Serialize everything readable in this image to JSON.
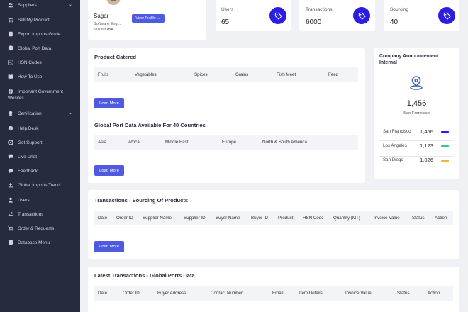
{
  "sidebar": {
    "items": [
      {
        "label": "Suppliers",
        "icon": "people-icon",
        "chevron": "⌄"
      },
      {
        "label": "Sell My Product",
        "icon": "cart-icon"
      },
      {
        "label": "Export Imports Guide",
        "icon": "book-icon"
      },
      {
        "label": "Global Port Data",
        "icon": "database-icon"
      },
      {
        "label": "HSN Codes",
        "icon": "code-icon"
      },
      {
        "label": "How To Use",
        "icon": "book-open-icon"
      },
      {
        "label": "Important Government Wesites",
        "icon": "globe-icon"
      },
      {
        "label": "Certification",
        "icon": "certificate-icon",
        "chevron": "⌄"
      },
      {
        "label": "Help Desk",
        "icon": "help-icon"
      },
      {
        "label": "Get Support",
        "icon": "support-icon"
      },
      {
        "label": "Live Chat",
        "icon": "chat-icon"
      },
      {
        "label": "Feedback",
        "icon": "feedback-icon"
      },
      {
        "label": "Global Imports Trend",
        "icon": "upload-icon"
      },
      {
        "label": "Users",
        "icon": "user-icon"
      },
      {
        "label": "Transactions",
        "icon": "transfer-icon"
      },
      {
        "label": "Order & Requests",
        "icon": "cart-icon"
      },
      {
        "label": "Database Menu",
        "icon": "database-icon"
      }
    ]
  },
  "profile": {
    "name": "Sagar",
    "role": "Software Eng...",
    "org": "Sukkur IBA",
    "button": "View Profile →"
  },
  "stats": [
    {
      "label": "Users",
      "value": "65"
    },
    {
      "label": "Transactions",
      "value": "6000"
    },
    {
      "label": "Sourcing",
      "value": "40"
    }
  ],
  "product_catered": {
    "title": "Product Catered",
    "columns": [
      "Fruits",
      "Vegetables",
      "Spices",
      "Grains",
      "Fish Meet",
      "Feed"
    ],
    "button": "Load More"
  },
  "port_data": {
    "title": "Global Port Data Available For 40 Countries",
    "columns": [
      "Asia",
      "Africa",
      "Middle East",
      "Europe",
      "North & South America"
    ],
    "button": "Load More"
  },
  "announcement": {
    "title_line1": "Company Announcement",
    "title_line2": "Internal",
    "big_value": "1,456",
    "big_city": "San Francisco",
    "rows": [
      {
        "city": "San Francisco",
        "value": "1,456",
        "color": "#2a1fe0"
      },
      {
        "city": "Los Angeles",
        "value": "1,123",
        "color": "#35c790"
      },
      {
        "city": "San Diego",
        "value": "1,026",
        "color": "#f0b43a"
      }
    ]
  },
  "transactions": {
    "title": "Transactions - Sourcing Of Products",
    "columns": [
      "Date",
      "Order ID",
      "Supplier Name",
      "Supplier ID",
      "Buyer Name",
      "Buyer ID",
      "Product",
      "HSN Code",
      "Quantity (MT)",
      "Invoice Value",
      "Status",
      "Action"
    ],
    "button": "Load More"
  },
  "latest": {
    "title": "Latest Transactions - Global Ports Data",
    "columns": [
      "Date",
      "Order ID",
      "Buyer Address",
      "Contact Number",
      "Email",
      "Item Details",
      "Invoice Value",
      "Status",
      "Action"
    ]
  },
  "colors": {
    "accent": "#4e5be0",
    "icon_circle": "#2a1fe0",
    "sidebar": "#262b3e"
  }
}
